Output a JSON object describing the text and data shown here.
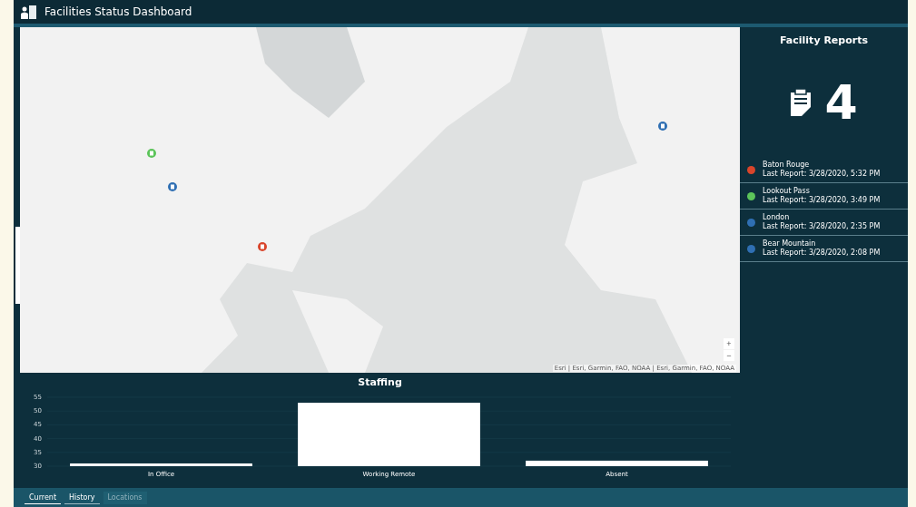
{
  "header": {
    "title": "Facilities Status Dashboard"
  },
  "map": {
    "attribution": "Esri | Esri, Garmin, FAO, NOAA | Esri, Garmin, FAO, NOAA",
    "zoom_in": "+",
    "zoom_out": "−",
    "pins": [
      {
        "color": "#d9452b"
      },
      {
        "color": "#5cc45a"
      },
      {
        "color": "#2f6fb3"
      },
      {
        "color": "#2f6fb3"
      }
    ]
  },
  "reports": {
    "title": "Facility Reports",
    "count": "4",
    "items": [
      {
        "name": "Baton Rouge",
        "detail": "Last Report: 3/28/2020, 5:32 PM",
        "color": "#d9452b"
      },
      {
        "name": "Lookout Pass",
        "detail": "Last Report: 3/28/2020, 3:49 PM",
        "color": "#5cc45a"
      },
      {
        "name": "London",
        "detail": "Last Report: 3/28/2020, 2:35 PM",
        "color": "#2f6fb3"
      },
      {
        "name": "Bear Mountain",
        "detail": "Last Report: 3/28/2020, 2:08 PM",
        "color": "#2f6fb3"
      }
    ]
  },
  "staffing": {
    "title": "Staffing",
    "chart_data": {
      "type": "bar",
      "categories": [
        "In Office",
        "Working Remote",
        "Absent"
      ],
      "values": [
        31,
        53,
        32
      ],
      "grid": true,
      "ylim": [
        30,
        55
      ],
      "yticks": [
        30,
        35,
        40,
        45,
        50,
        55
      ]
    }
  },
  "tabs": [
    {
      "label": "Current",
      "selected": true,
      "disabled": false
    },
    {
      "label": "History",
      "selected": false,
      "disabled": false
    },
    {
      "label": "Locations",
      "selected": false,
      "disabled": true
    }
  ]
}
